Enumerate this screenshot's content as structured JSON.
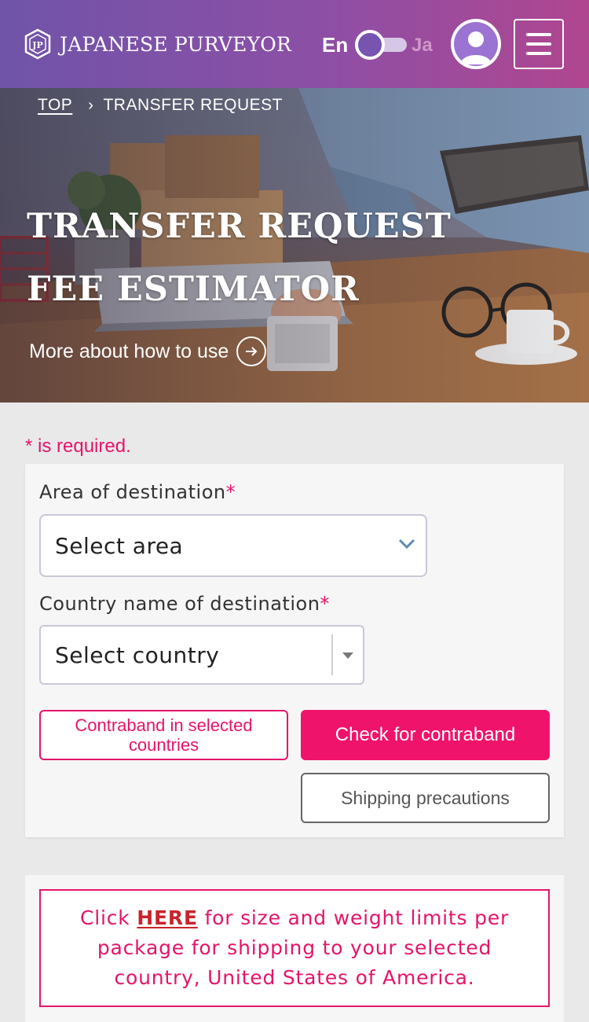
{
  "header": {
    "logo_text": "JAPANESE PURVEYOR",
    "language_current": "En",
    "language_other": "Ja"
  },
  "breadcrumb": {
    "home": "TOP",
    "current": "TRANSFER REQUEST"
  },
  "hero": {
    "title_line1": "TRANSFER REQUEST",
    "title_line2": "FEE ESTIMATOR",
    "link_text": "More about how to use"
  },
  "form": {
    "required_note": "* is required.",
    "area_label": "Area of destination",
    "area_placeholder": "Select area",
    "country_label": "Country name of destination",
    "country_placeholder": "Select country",
    "required_star": "*",
    "contraband_list_button": "Contraband in selected countries",
    "check_contraband_button": "Check for contraband",
    "shipping_precautions_button": "Shipping precautions"
  },
  "info": {
    "prefix": "Click ",
    "link_text": "HERE",
    "suffix": " for size and weight limits per package for shipping to your selected country, United States of America."
  },
  "colors": {
    "header_gradient_start": "#6f54a8",
    "header_gradient_end": "#b0468f",
    "accent_pink": "#f0136c",
    "link_red": "#c8242c"
  },
  "icons": {
    "logo": "logo-icon",
    "avatar": "user-avatar-icon",
    "menu": "hamburger-menu-icon",
    "breadcrumb_separator": "chevron-right-icon",
    "hero_link": "arrow-right-circle-icon",
    "area_select": "chevron-down-icon",
    "country_select": "caret-down-icon"
  }
}
